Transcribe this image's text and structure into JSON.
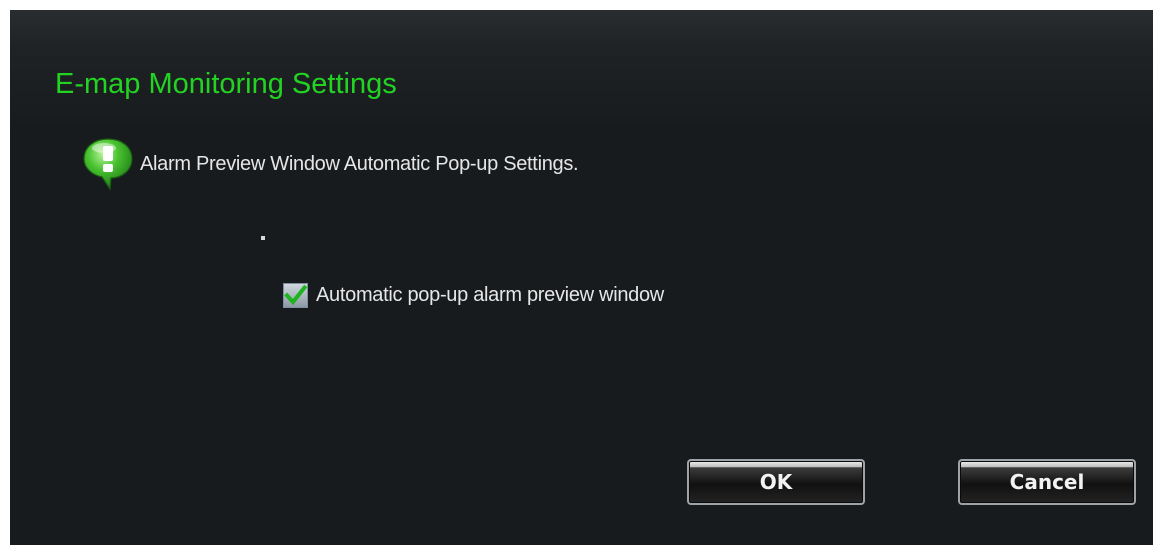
{
  "dialog": {
    "title": "E-map Monitoring Settings",
    "info_icon": "exclamation-speech-bubble-icon",
    "info_text": "Alarm Preview Window Automatic Pop-up Settings.",
    "dot": "."
  },
  "option": {
    "label": "Automatic pop-up alarm preview window",
    "checked": true
  },
  "buttons": {
    "ok_label": "OK",
    "cancel_label": "Cancel"
  },
  "colors": {
    "title": "#22d322",
    "background": "#181b1e",
    "check_mark": "#1db51d"
  }
}
